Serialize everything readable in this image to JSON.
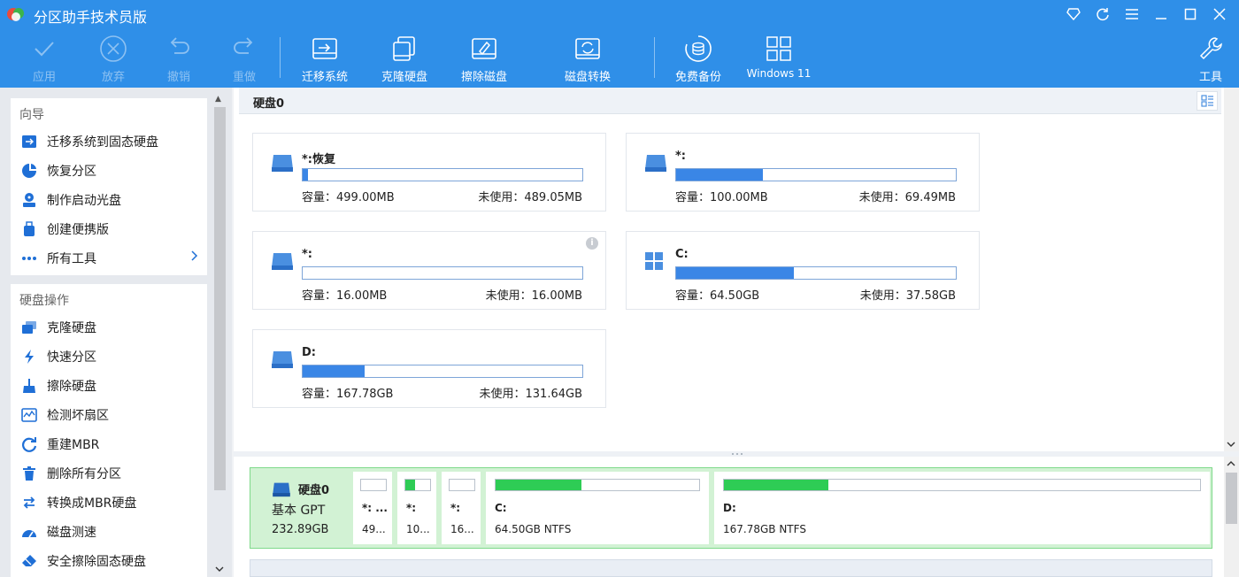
{
  "app": {
    "title": "分区助手技术员版"
  },
  "toolbar": {
    "apply": "应用",
    "discard": "放弃",
    "undo": "撤销",
    "redo": "重做",
    "migrate": "迁移系统",
    "clone": "克隆硬盘",
    "wipe": "擦除磁盘",
    "convert": "磁盘转换",
    "backup": "免费备份",
    "win11": "Windows 11",
    "tools": "工具"
  },
  "sidebar": {
    "wizard_title": "向导",
    "wizard_items": [
      {
        "label": "迁移系统到固态硬盘"
      },
      {
        "label": "恢复分区"
      },
      {
        "label": "制作启动光盘"
      },
      {
        "label": "创建便携版"
      },
      {
        "label": "所有工具"
      }
    ],
    "disk_ops_title": "硬盘操作",
    "disk_ops_items": [
      {
        "label": "克隆硬盘"
      },
      {
        "label": "快速分区"
      },
      {
        "label": "擦除硬盘"
      },
      {
        "label": "检测坏扇区"
      },
      {
        "label": "重建MBR"
      },
      {
        "label": "删除所有分区"
      },
      {
        "label": "转换成MBR硬盘"
      },
      {
        "label": "磁盘测速"
      },
      {
        "label": "安全擦除固态硬盘"
      }
    ]
  },
  "main": {
    "disk_header": "硬盘0",
    "partitions": [
      {
        "name": "*:恢复",
        "capacity": "容量：499.00MB",
        "unused": "未使用：489.05MB",
        "used_fraction": 0.02
      },
      {
        "name": "*:",
        "capacity": "容量：100.00MB",
        "unused": "未使用：69.49MB",
        "used_fraction": 0.31
      },
      {
        "name": "*:",
        "capacity": "容量：16.00MB",
        "unused": "未使用：16.00MB",
        "used_fraction": 0.0
      },
      {
        "name": "C:",
        "capacity": "容量：64.50GB",
        "unused": "未使用：37.58GB",
        "used_fraction": 0.42
      },
      {
        "name": "D:",
        "capacity": "容量：167.78GB",
        "unused": "未使用：131.64GB",
        "used_fraction": 0.22
      }
    ]
  },
  "disk_map": {
    "name": "硬盘0",
    "type": "基本 GPT",
    "size": "232.89GB",
    "blocks": [
      {
        "name": "*: ...",
        "info": "49...",
        "used_fraction": 0.0
      },
      {
        "name": "*:",
        "info": "10...",
        "used_fraction": 0.4
      },
      {
        "name": "*:",
        "info": "16...",
        "used_fraction": 0.0
      },
      {
        "name": "C:",
        "info": "64.50GB NTFS",
        "used_fraction": 0.42
      },
      {
        "name": "D:",
        "info": "167.78GB NTFS",
        "used_fraction": 0.22
      }
    ]
  }
}
